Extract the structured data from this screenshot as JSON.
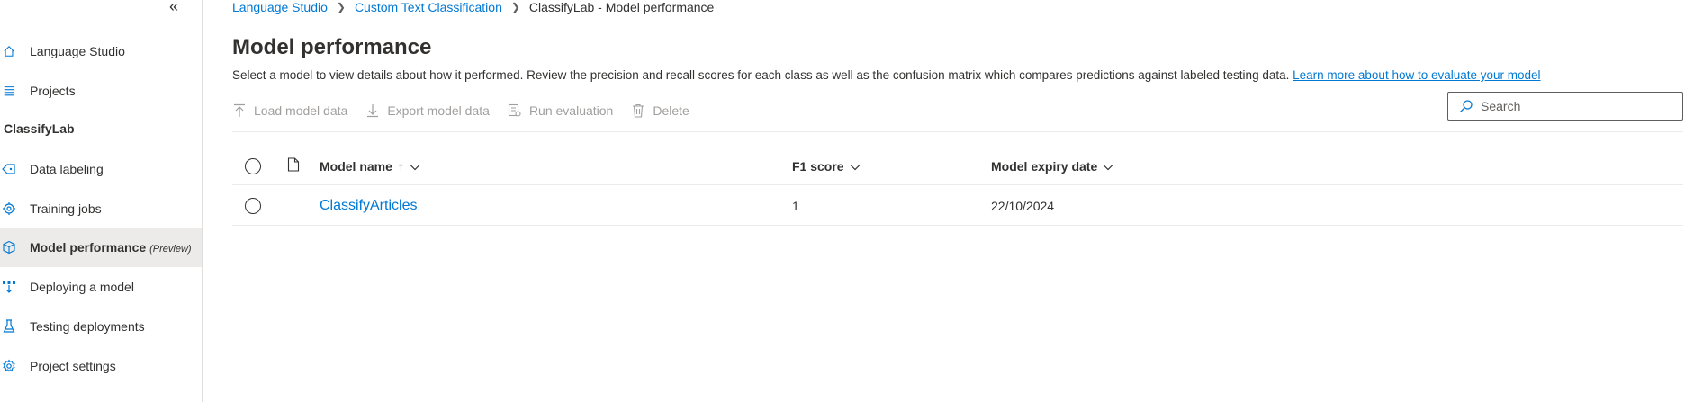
{
  "sidebar": {
    "collapse_glyph": "«",
    "items": [
      {
        "label": "Language Studio",
        "icon": "home-icon"
      },
      {
        "label": "Projects",
        "icon": "list-icon"
      }
    ],
    "section_label": "ClassifyLab",
    "project_items": [
      {
        "label": "Data labeling",
        "icon": "tag-icon"
      },
      {
        "label": "Training jobs",
        "icon": "training-icon"
      },
      {
        "label": "Model performance",
        "badge": "(Preview)",
        "icon": "cube-icon",
        "selected": true
      },
      {
        "label": "Deploying a model",
        "icon": "deploy-icon"
      },
      {
        "label": "Testing deployments",
        "icon": "flask-icon"
      },
      {
        "label": "Project settings",
        "icon": "gear-icon"
      }
    ]
  },
  "breadcrumb": {
    "items": [
      "Language Studio",
      "Custom Text Classification"
    ],
    "current": "ClassifyLab - Model performance"
  },
  "page": {
    "title": "Model performance",
    "description": "Select a model to view details about how it performed. Review the precision and recall scores for each class as well as the confusion matrix which compares predictions against labeled testing data.",
    "learn_more": "Learn more about how to evaluate your model"
  },
  "toolbar": {
    "load": "Load model data",
    "export": "Export model data",
    "run": "Run evaluation",
    "delete": "Delete"
  },
  "search": {
    "placeholder": "Search"
  },
  "table": {
    "columns": {
      "name": "Model name",
      "name_sort": "↑",
      "f1": "F1 score",
      "expiry": "Model expiry date"
    },
    "rows": [
      {
        "name": "ClassifyArticles",
        "f1": "1",
        "expiry": "22/10/2024"
      }
    ]
  },
  "colors": {
    "accent": "#0078d4",
    "text": "#323130",
    "disabled": "#a19f9d",
    "selected_bg": "#edebe9"
  }
}
